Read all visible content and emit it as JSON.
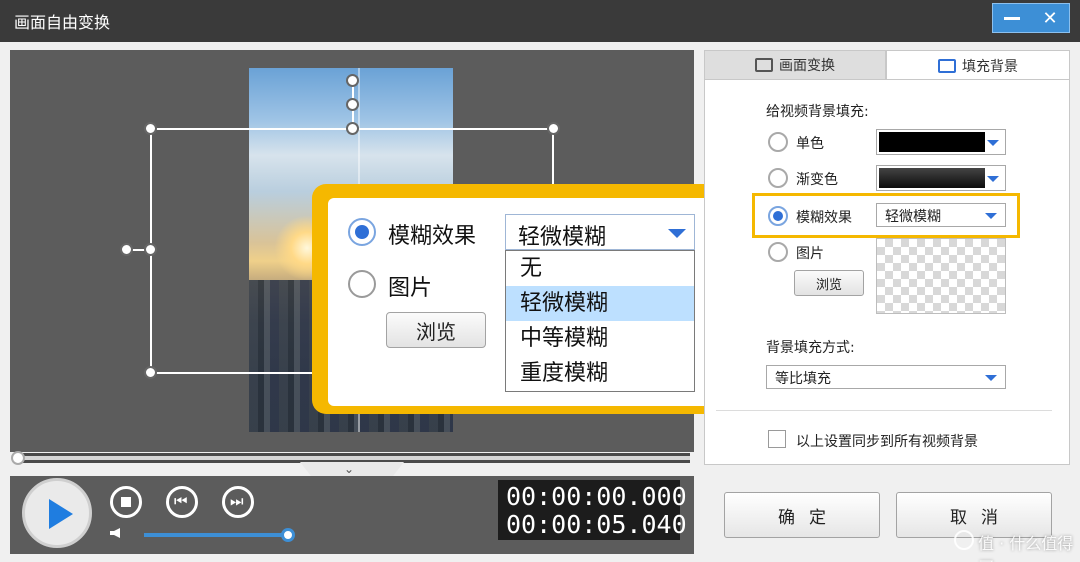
{
  "window": {
    "title": "画面自由变换",
    "minimize_icon": "minimize-icon",
    "close_glyph": "✕"
  },
  "zoom_callout": {
    "blur_label": "模糊效果",
    "image_label": "图片",
    "browse_label": "浏览",
    "selected_value": "轻微模糊",
    "options": [
      "无",
      "轻微模糊",
      "中等模糊",
      "重度模糊"
    ],
    "selected_index": 1,
    "accent": "#f5b800"
  },
  "transport": {
    "time_current": "00:00:00.000",
    "time_total": "00:00:05.040",
    "progress_fraction": 0,
    "volume_fraction": 1,
    "fold_glyph": "⌄",
    "prev_glyph": "⏮",
    "next_glyph": "⏭"
  },
  "tabs": [
    {
      "label": "画面变换",
      "icon": "crop-icon",
      "active": false
    },
    {
      "label": "填充背景",
      "icon": "fill-background-icon",
      "active": true
    }
  ],
  "fill_panel": {
    "heading": "给视频背景填充:",
    "options": [
      {
        "label": "单色",
        "checked": false,
        "control": "color-picker",
        "color": "#000000"
      },
      {
        "label": "渐变色",
        "checked": false,
        "control": "gradient-picker",
        "color": "#1a1a1a"
      },
      {
        "label": "模糊效果",
        "checked": true,
        "control": "select",
        "value": "轻微模糊"
      },
      {
        "label": "图片",
        "checked": false,
        "control": "image",
        "browse_label": "浏览"
      }
    ],
    "mode_label": "背景填充方式:",
    "mode_value": "等比填充",
    "sync_label": "以上设置同步到所有视频背景",
    "sync_checked": false
  },
  "buttons": {
    "ok": "确定",
    "cancel": "取消"
  },
  "watermark": "值 · 什么值得买",
  "colors": {
    "titlebar": "#3a3a3a",
    "accent_blue": "#2f6fd6",
    "highlight_yellow": "#f5b800",
    "preview_bg": "#5c5c5c"
  }
}
